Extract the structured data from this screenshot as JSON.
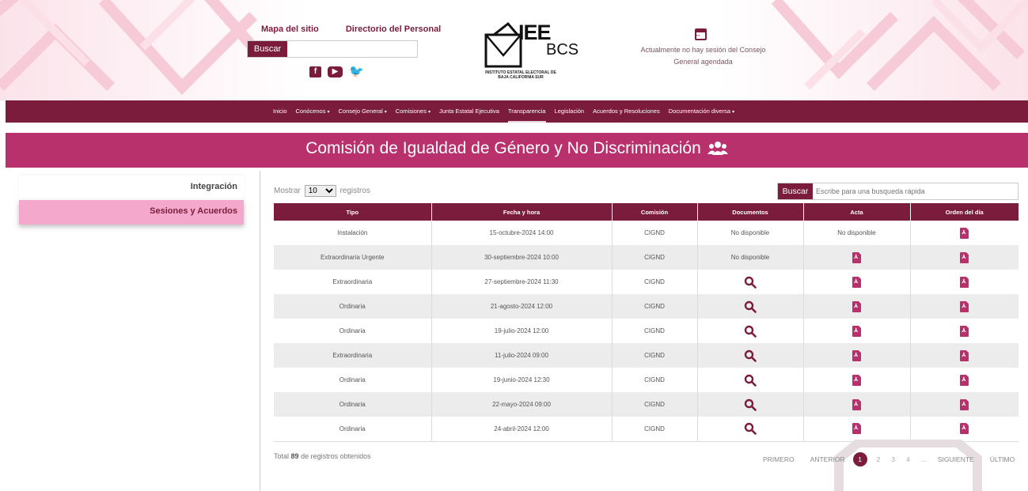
{
  "header": {
    "links": [
      "Mapa del sitio",
      "Directorio del Personal"
    ],
    "search_label": "Buscar",
    "search_value": "",
    "socials": [
      "facebook-icon",
      "youtube-icon",
      "twitter-icon"
    ],
    "logo_top": "IEE",
    "logo_bottom": "BCS",
    "logo_caption": "INSTITUTO ESTATAL ELECTORAL DE BAJA CALIFORNIA SUR",
    "session_text": "Actualmente no hay sesión del Consejo General agendada"
  },
  "nav": {
    "items": [
      {
        "label": "Inicio",
        "caret": ""
      },
      {
        "label": "Conócenos",
        "caret": "▾"
      },
      {
        "label": "Consejo General",
        "caret": "▾"
      },
      {
        "label": "Comisiones",
        "caret": "▾"
      },
      {
        "label": "Junta Estatal Ejecutiva",
        "caret": ""
      },
      {
        "label": "Transparencia",
        "caret": ""
      },
      {
        "label": "Legislación",
        "caret": ""
      },
      {
        "label": "Acuerdos y Resoluciones",
        "caret": ""
      },
      {
        "label": "Documentación diversa",
        "caret": "▾"
      }
    ],
    "active_index": 5
  },
  "title": "Comisión de Igualdad de Género y No Discriminación",
  "sidebar": {
    "items": [
      "Integración",
      "Sesiones y Acuerdos"
    ],
    "active_index": 1
  },
  "controls": {
    "show_prefix": "Mostrar",
    "show_value": "10",
    "show_suffix": "registros",
    "search_label": "Buscar",
    "search_placeholder": "Escribe para una busqueda rápida"
  },
  "table": {
    "headers": [
      "Tipo",
      "Fecha y hora",
      "Comisión",
      "Documentos",
      "Acta",
      "Orden del día"
    ],
    "rows": [
      {
        "tipo": "Instalación",
        "fecha": "15-octubre-2024 14:00",
        "comision": "CIGND",
        "documentos": "No disponible",
        "acta": "No disponible",
        "orden": "pdf"
      },
      {
        "tipo": "Extraordinaria Urgente",
        "fecha": "30-septiembre-2024 10:00",
        "comision": "CIGND",
        "documentos": "No disponible",
        "acta": "pdf",
        "orden": "pdf"
      },
      {
        "tipo": "Extraordinaria",
        "fecha": "27-septiembre-2024 11:30",
        "comision": "CIGND",
        "documentos": "search",
        "acta": "pdf",
        "orden": "pdf"
      },
      {
        "tipo": "Ordinaria",
        "fecha": "21-agosto-2024 12:00",
        "comision": "CIGND",
        "documentos": "search",
        "acta": "pdf",
        "orden": "pdf"
      },
      {
        "tipo": "Ordinaria",
        "fecha": "19-julio-2024 12:00",
        "comision": "CIGND",
        "documentos": "search",
        "acta": "pdf",
        "orden": "pdf"
      },
      {
        "tipo": "Extraordinaria",
        "fecha": "11-julio-2024 09:00",
        "comision": "CIGND",
        "documentos": "search",
        "acta": "pdf",
        "orden": "pdf"
      },
      {
        "tipo": "Ordinaria",
        "fecha": "19-junio-2024 12:30",
        "comision": "CIGND",
        "documentos": "search",
        "acta": "pdf",
        "orden": "pdf"
      },
      {
        "tipo": "Ordinaria",
        "fecha": "22-mayo-2024 09:00",
        "comision": "CIGND",
        "documentos": "search",
        "acta": "pdf",
        "orden": "pdf"
      },
      {
        "tipo": "Ordinaria",
        "fecha": "24-abril-2024 12:00",
        "comision": "CIGND",
        "documentos": "search",
        "acta": "pdf",
        "orden": "pdf"
      }
    ]
  },
  "footer": {
    "total_prefix": "Total",
    "total_count": "89",
    "total_suffix": "de registros obtenidos",
    "pager": {
      "first": "PRIMERO",
      "prev": "ANTERIOR",
      "pages": [
        "1",
        "2",
        "3",
        "4"
      ],
      "current": "1",
      "ellipsis": "...",
      "next": "SIGUIENTE",
      "last": "ÚLTIMO"
    }
  },
  "colors": {
    "primary": "#7b1c3c",
    "magenta": "#b8306c",
    "pink": "#f4a9cc"
  }
}
